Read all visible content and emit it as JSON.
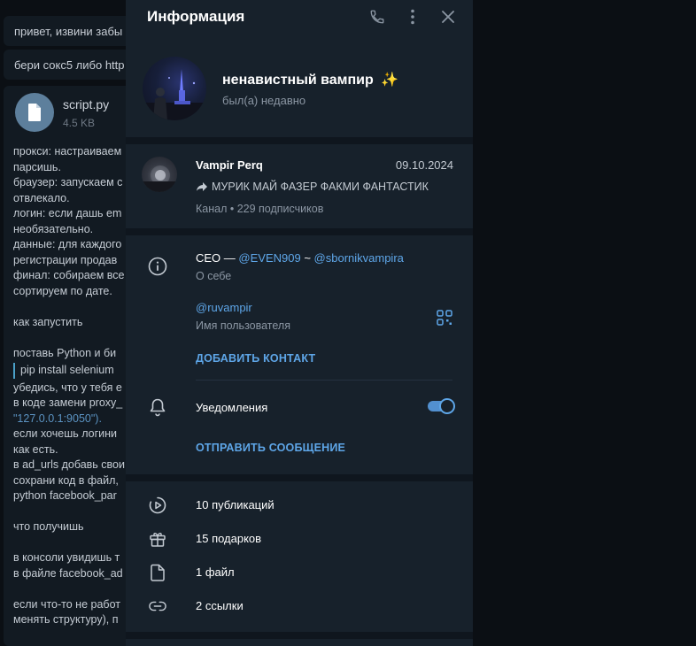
{
  "background_chat": {
    "messages": [
      "привет, извини забы",
      "бери сокс5 либо http"
    ],
    "file": {
      "name": "script.py",
      "size": "4.5 KB"
    },
    "lines": [
      "прокси: настраиваем",
      "парсишь.",
      "браузер: запускаем с",
      "отвлекало.",
      "логин: если дашь em",
      "необязательно.",
      "данные: для каждого",
      "регистрации продав",
      "финал: собираем все",
      "сортируем по дате.",
      "",
      "как запустить",
      "",
      "поставь Python и би",
      "pip install selenium",
      "убедись, что у тебя е",
      "в коде замени proxy_",
      "\"127.0.0.1:9050\").",
      "если хочешь логини",
      "как есть.",
      "в ad_urls добавь свои",
      "сохрани код в файл,",
      "python facebook_par",
      "",
      "что получишь",
      "",
      "в консоли увидишь т",
      "в файле facebook_ad",
      "",
      "если что-то не работ",
      "менять структуру), п"
    ]
  },
  "panel": {
    "title": "Информация",
    "icons": {
      "call": "phone-icon",
      "more": "more-vertical-icon",
      "close": "close-icon"
    },
    "profile": {
      "name": "ненавистный вампир",
      "emoji": "✨",
      "status": "был(а) недавно"
    },
    "channel": {
      "name": "Vampir Perq",
      "date": "09.10.2024",
      "last_message": "МУРИК МАЙ ФАЗЕР ФАКМИ ФАНТАСТИК",
      "subscribers": "Канал • 229 подписчиков"
    },
    "info": {
      "bio_prefix": "CEO — ",
      "bio_link1": "@EVEN909",
      "bio_sep": " ~ ",
      "bio_link2": "@sbornikvampira",
      "bio_label": "О себе",
      "username": "@ruvampir",
      "username_label": "Имя пользователя",
      "add_contact": "ДОБАВИТЬ КОНТАКТ",
      "notifications_label": "Уведомления",
      "notifications_on": true,
      "send_message": "ОТПРАВИТЬ СООБЩЕНИЕ"
    },
    "stats": [
      {
        "icon": "play-circle-icon",
        "label": "10 публикаций"
      },
      {
        "icon": "gift-icon",
        "label": "15 подарков"
      },
      {
        "icon": "file-icon",
        "label": "1 файл"
      },
      {
        "icon": "link-icon",
        "label": "2 ссылки"
      }
    ],
    "colors": {
      "accent": "#5ea6e8",
      "panel_bg": "#17212b",
      "separator": "#0f161e"
    }
  }
}
